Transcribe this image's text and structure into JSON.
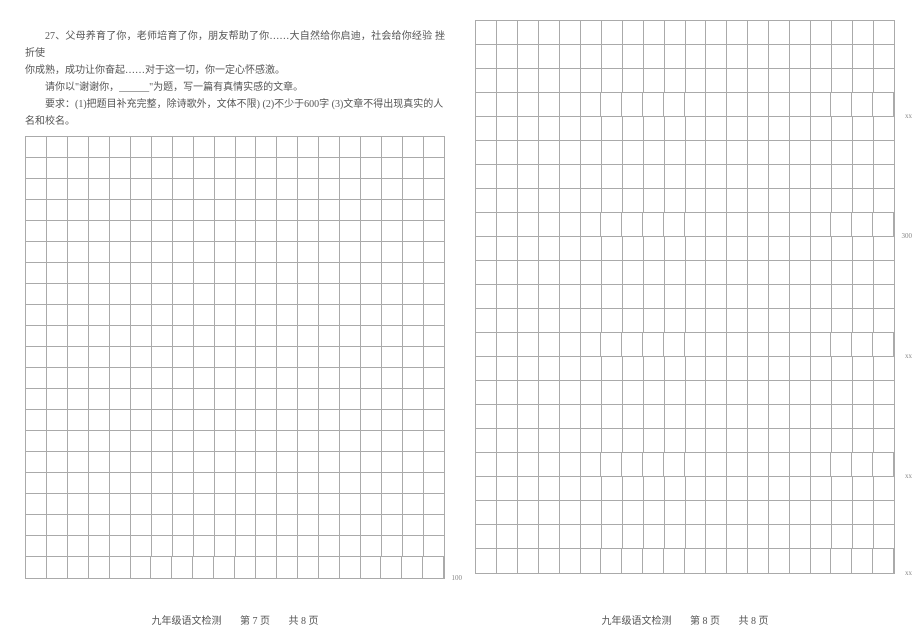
{
  "prompt": {
    "q_number": "27、",
    "line1": "父母养育了你，老师培育了你，朋友帮助了你……大自然给你启迪，社会给你经验 挫折使",
    "line2_prefix": "你成熟，成功让你奋起……对于这一切，你一定心怀感激。",
    "line3": "请你以\"谢谢你，______\"为题，写一篇有真情实感的文章。",
    "line4": "要求：(1)把题目补充完整，除诗歌外，文体不限) (2)不少于600字 (3)文章不得出现真实的人",
    "line5_prefix": "名和校名。"
  },
  "grid": {
    "left_rows": 21,
    "right_rows": 23,
    "cols": 20,
    "left_marker_row": 21,
    "left_marker_text": "100",
    "right_markers": [
      {
        "row": 4,
        "text": "xx"
      },
      {
        "row": 9,
        "text": "300"
      },
      {
        "row": 14,
        "text": "xx"
      },
      {
        "row": 19,
        "text": "xx"
      },
      {
        "row": 23,
        "text": "xx"
      }
    ]
  },
  "footer": {
    "subject": "九年级语文检测",
    "left_page": "第 7 页",
    "right_page": "第 8 页",
    "total": "共 8 页"
  }
}
